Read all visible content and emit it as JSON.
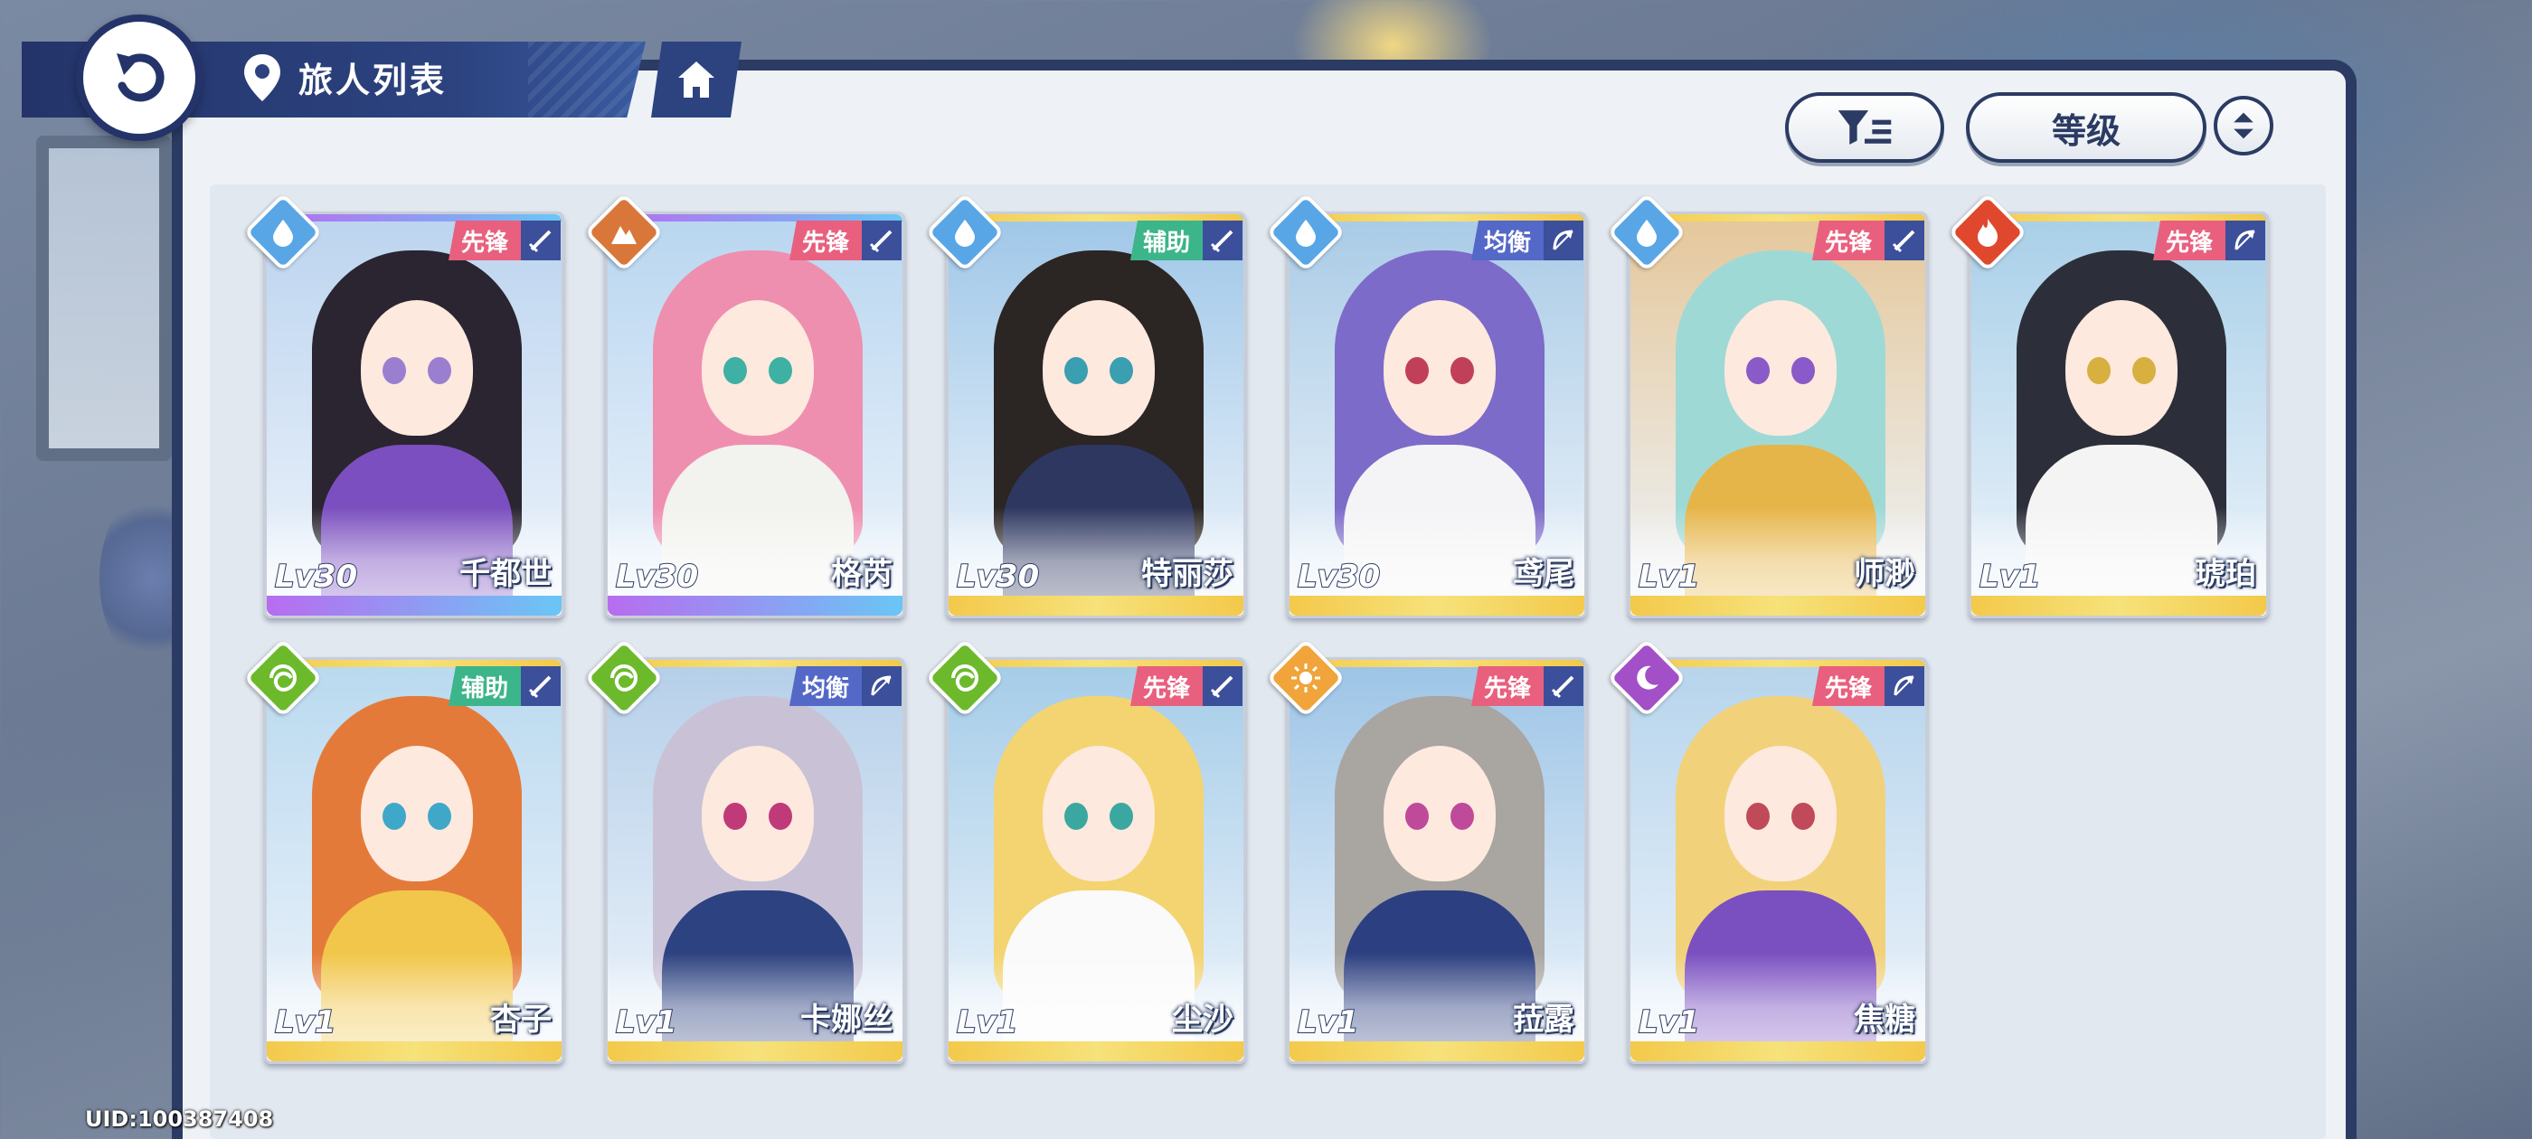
{
  "header": {
    "title": "旅人列表"
  },
  "toolbar": {
    "sort_label": "等级"
  },
  "footer": {
    "uid": "UID:100387408"
  },
  "colors": {
    "navy": "#2b3b63",
    "water": "#58a6e6",
    "earth": "#d9773a",
    "fire": "#e0482e",
    "wind": "#6cba2c",
    "light": "#f0a43a",
    "dark": "#a24fc8",
    "role_vanguard": "#e8607e",
    "role_support": "#3cb58a",
    "role_balance": "#5468c8"
  },
  "characters": [
    {
      "name": "千都世",
      "level": "Lv30",
      "role": "先锋",
      "element": "water-icon",
      "class": "sword-icon",
      "rarity": "purple",
      "hair": "#2a2530",
      "accent": "#7b4fbf",
      "eyes": "#9a7fd0",
      "sky": "#bcd4ef"
    },
    {
      "name": "格芮",
      "level": "Lv30",
      "role": "先锋",
      "element": "earth-icon",
      "class": "sword-icon",
      "rarity": "purple",
      "hair": "#ef8fb0",
      "accent": "#f2f2ee",
      "eyes": "#3fb0a4",
      "sky": "#b8d6f0"
    },
    {
      "name": "特丽莎",
      "level": "Lv30",
      "role": "辅助",
      "element": "water-icon",
      "class": "sword-icon",
      "rarity": "gold",
      "hair": "#2b2523",
      "accent": "#2e3760",
      "eyes": "#3a9fb0",
      "sky": "#9fc7e8"
    },
    {
      "name": "鸢尾",
      "level": "Lv30",
      "role": "均衡",
      "element": "water-icon",
      "class": "bow-icon",
      "rarity": "gold",
      "hair": "#7c6bc8",
      "accent": "#f4f4f6",
      "eyes": "#c0405a",
      "sky": "#a9cbe6"
    },
    {
      "name": "师渺",
      "level": "Lv1",
      "role": "先锋",
      "element": "water-icon",
      "class": "sword-icon",
      "rarity": "gold",
      "hair": "#9fd9d6",
      "accent": "#e6b54a",
      "eyes": "#8a5ac8",
      "sky": "#e5c79a"
    },
    {
      "name": "琥珀",
      "level": "Lv1",
      "role": "先锋",
      "element": "fire-icon",
      "class": "bow-icon",
      "rarity": "gold",
      "hair": "#2c2f3a",
      "accent": "#f4f4f4",
      "eyes": "#d8b040",
      "sky": "#a8cfe8"
    },
    {
      "name": "杏子",
      "level": "Lv1",
      "role": "辅助",
      "element": "wind-icon",
      "class": "sword-icon",
      "rarity": "gold",
      "hair": "#e47a3a",
      "accent": "#f1c64a",
      "eyes": "#3fa8c8",
      "sky": "#b9d9ef"
    },
    {
      "name": "卡娜丝",
      "level": "Lv1",
      "role": "均衡",
      "element": "wind-icon",
      "class": "bow-icon",
      "rarity": "gold",
      "hair": "#c9c2d6",
      "accent": "#2d4280",
      "eyes": "#c03a7a",
      "sky": "#b5cfe9"
    },
    {
      "name": "尘沙",
      "level": "Lv1",
      "role": "先锋",
      "element": "wind-icon",
      "class": "sword-icon",
      "rarity": "gold",
      "hair": "#f3d470",
      "accent": "#fafafa",
      "eyes": "#3aa8a0",
      "sky": "#a4cce8"
    },
    {
      "name": "菈露",
      "level": "Lv1",
      "role": "先锋",
      "element": "light-icon",
      "class": "sword-icon",
      "rarity": "gold",
      "hair": "#a9a5a0",
      "accent": "#2c3f80",
      "eyes": "#c04a9a",
      "sky": "#9cc4e6"
    },
    {
      "name": "焦糖",
      "level": "Lv1",
      "role": "先锋",
      "element": "dark-icon",
      "class": "bow-icon",
      "rarity": "gold",
      "hair": "#f1d27a",
      "accent": "#7a4fc0",
      "eyes": "#c04a5a",
      "sky": "#b6d4ec"
    }
  ]
}
